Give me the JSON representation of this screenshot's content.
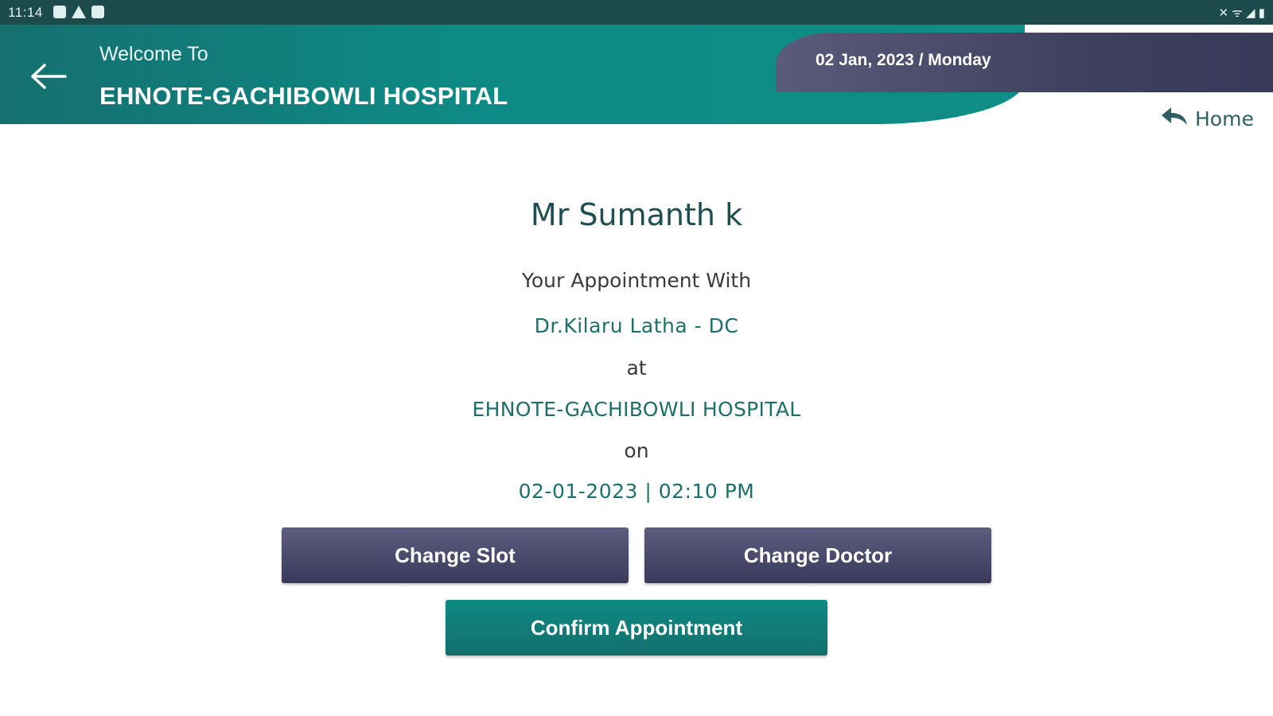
{
  "status_bar": {
    "time": "11:14",
    "right_icons": "✕ ᯤ ◢ ▮"
  },
  "header": {
    "welcome": "Welcome To",
    "hospital": "EHNOTE-GACHIBOWLI HOSPITAL",
    "date": "02 Jan, 2023 / Monday"
  },
  "nav": {
    "home_label": "Home"
  },
  "appointment": {
    "patient_name": "Mr Sumanth k",
    "with_label": "Your Appointment With",
    "doctor": "Dr.Kilaru Latha - DC",
    "at_label": "at",
    "hospital": "EHNOTE-GACHIBOWLI HOSPITAL",
    "on_label": "on",
    "datetime": "02-01-2023 | 02:10  PM"
  },
  "buttons": {
    "change_slot": "Change Slot",
    "change_doctor": "Change Doctor",
    "confirm": "Confirm Appointment"
  },
  "colors": {
    "header_teal": "#0d8a85",
    "panel_dark": "#3f3f5e",
    "text_teal": "#1d6f6c"
  }
}
